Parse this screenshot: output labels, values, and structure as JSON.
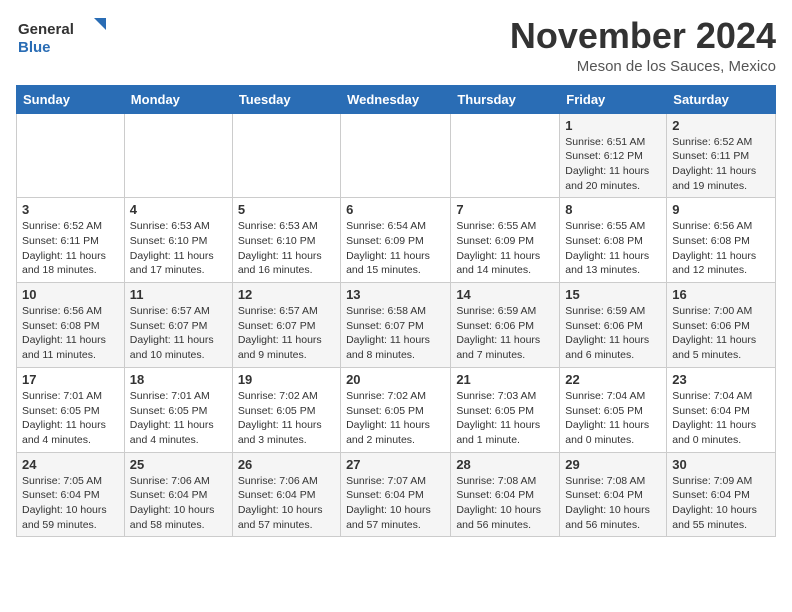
{
  "logo": {
    "general": "General",
    "blue": "Blue"
  },
  "title": {
    "month_year": "November 2024",
    "location": "Meson de los Sauces, Mexico"
  },
  "days_of_week": [
    "Sunday",
    "Monday",
    "Tuesday",
    "Wednesday",
    "Thursday",
    "Friday",
    "Saturday"
  ],
  "weeks": [
    [
      {
        "day": "",
        "info": ""
      },
      {
        "day": "",
        "info": ""
      },
      {
        "day": "",
        "info": ""
      },
      {
        "day": "",
        "info": ""
      },
      {
        "day": "",
        "info": ""
      },
      {
        "day": "1",
        "info": "Sunrise: 6:51 AM\nSunset: 6:12 PM\nDaylight: 11 hours and 20 minutes."
      },
      {
        "day": "2",
        "info": "Sunrise: 6:52 AM\nSunset: 6:11 PM\nDaylight: 11 hours and 19 minutes."
      }
    ],
    [
      {
        "day": "3",
        "info": "Sunrise: 6:52 AM\nSunset: 6:11 PM\nDaylight: 11 hours and 18 minutes."
      },
      {
        "day": "4",
        "info": "Sunrise: 6:53 AM\nSunset: 6:10 PM\nDaylight: 11 hours and 17 minutes."
      },
      {
        "day": "5",
        "info": "Sunrise: 6:53 AM\nSunset: 6:10 PM\nDaylight: 11 hours and 16 minutes."
      },
      {
        "day": "6",
        "info": "Sunrise: 6:54 AM\nSunset: 6:09 PM\nDaylight: 11 hours and 15 minutes."
      },
      {
        "day": "7",
        "info": "Sunrise: 6:55 AM\nSunset: 6:09 PM\nDaylight: 11 hours and 14 minutes."
      },
      {
        "day": "8",
        "info": "Sunrise: 6:55 AM\nSunset: 6:08 PM\nDaylight: 11 hours and 13 minutes."
      },
      {
        "day": "9",
        "info": "Sunrise: 6:56 AM\nSunset: 6:08 PM\nDaylight: 11 hours and 12 minutes."
      }
    ],
    [
      {
        "day": "10",
        "info": "Sunrise: 6:56 AM\nSunset: 6:08 PM\nDaylight: 11 hours and 11 minutes."
      },
      {
        "day": "11",
        "info": "Sunrise: 6:57 AM\nSunset: 6:07 PM\nDaylight: 11 hours and 10 minutes."
      },
      {
        "day": "12",
        "info": "Sunrise: 6:57 AM\nSunset: 6:07 PM\nDaylight: 11 hours and 9 minutes."
      },
      {
        "day": "13",
        "info": "Sunrise: 6:58 AM\nSunset: 6:07 PM\nDaylight: 11 hours and 8 minutes."
      },
      {
        "day": "14",
        "info": "Sunrise: 6:59 AM\nSunset: 6:06 PM\nDaylight: 11 hours and 7 minutes."
      },
      {
        "day": "15",
        "info": "Sunrise: 6:59 AM\nSunset: 6:06 PM\nDaylight: 11 hours and 6 minutes."
      },
      {
        "day": "16",
        "info": "Sunrise: 7:00 AM\nSunset: 6:06 PM\nDaylight: 11 hours and 5 minutes."
      }
    ],
    [
      {
        "day": "17",
        "info": "Sunrise: 7:01 AM\nSunset: 6:05 PM\nDaylight: 11 hours and 4 minutes."
      },
      {
        "day": "18",
        "info": "Sunrise: 7:01 AM\nSunset: 6:05 PM\nDaylight: 11 hours and 4 minutes."
      },
      {
        "day": "19",
        "info": "Sunrise: 7:02 AM\nSunset: 6:05 PM\nDaylight: 11 hours and 3 minutes."
      },
      {
        "day": "20",
        "info": "Sunrise: 7:02 AM\nSunset: 6:05 PM\nDaylight: 11 hours and 2 minutes."
      },
      {
        "day": "21",
        "info": "Sunrise: 7:03 AM\nSunset: 6:05 PM\nDaylight: 11 hours and 1 minute."
      },
      {
        "day": "22",
        "info": "Sunrise: 7:04 AM\nSunset: 6:05 PM\nDaylight: 11 hours and 0 minutes."
      },
      {
        "day": "23",
        "info": "Sunrise: 7:04 AM\nSunset: 6:04 PM\nDaylight: 11 hours and 0 minutes."
      }
    ],
    [
      {
        "day": "24",
        "info": "Sunrise: 7:05 AM\nSunset: 6:04 PM\nDaylight: 10 hours and 59 minutes."
      },
      {
        "day": "25",
        "info": "Sunrise: 7:06 AM\nSunset: 6:04 PM\nDaylight: 10 hours and 58 minutes."
      },
      {
        "day": "26",
        "info": "Sunrise: 7:06 AM\nSunset: 6:04 PM\nDaylight: 10 hours and 57 minutes."
      },
      {
        "day": "27",
        "info": "Sunrise: 7:07 AM\nSunset: 6:04 PM\nDaylight: 10 hours and 57 minutes."
      },
      {
        "day": "28",
        "info": "Sunrise: 7:08 AM\nSunset: 6:04 PM\nDaylight: 10 hours and 56 minutes."
      },
      {
        "day": "29",
        "info": "Sunrise: 7:08 AM\nSunset: 6:04 PM\nDaylight: 10 hours and 56 minutes."
      },
      {
        "day": "30",
        "info": "Sunrise: 7:09 AM\nSunset: 6:04 PM\nDaylight: 10 hours and 55 minutes."
      }
    ]
  ]
}
